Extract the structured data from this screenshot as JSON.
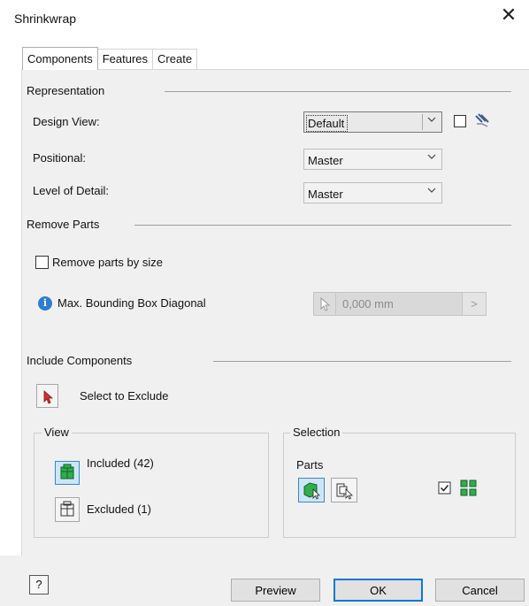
{
  "window": {
    "title": "Shrinkwrap",
    "close_label": "✕"
  },
  "tabs": [
    "Components",
    "Features",
    "Create"
  ],
  "representation": {
    "heading": "Representation",
    "design_view_label": "Design View:",
    "design_view_value": "Default",
    "positional_label": "Positional:",
    "positional_value": "Master",
    "lod_label": "Level of Detail:",
    "lod_value": "Master"
  },
  "remove_parts": {
    "heading": "Remove Parts",
    "checkbox_label": "Remove parts by size",
    "checked": false,
    "max_label": "Max. Bounding Box Diagonal",
    "max_value": "0,000 mm",
    "more": ">"
  },
  "include": {
    "heading": "Include Components",
    "select_label": "Select to Exclude"
  },
  "view_group": {
    "title": "View",
    "included_label": "Included (42)",
    "excluded_label": "Excluded (1)"
  },
  "selection_group": {
    "title": "Selection",
    "parts_label": "Parts",
    "checked": true
  },
  "footer": {
    "preview": "Preview",
    "ok": "OK",
    "cancel": "Cancel",
    "help": "?"
  },
  "colors": {
    "accent": "#0a78d4",
    "panel_bg": "#f0f0f0",
    "icon_green": "#1f9d3a",
    "info_blue": "#2d7dd2",
    "cursor_red": "#d9302c"
  }
}
